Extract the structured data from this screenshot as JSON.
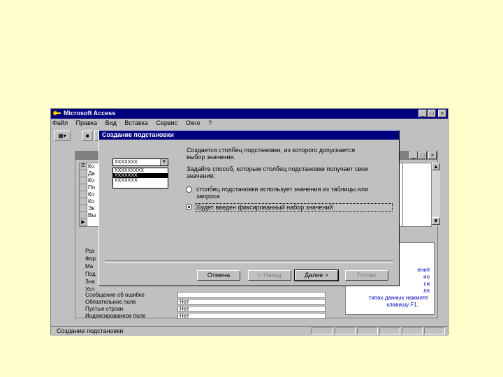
{
  "app": {
    "title": "Microsoft Access",
    "window_buttons": [
      "_",
      "□",
      "×"
    ],
    "menu": [
      "Файл",
      "Правка",
      "Вид",
      "Вставка",
      "Сервис",
      "Окно",
      "?"
    ]
  },
  "table_rows": [
    "Ко",
    "Да",
    "Ко",
    "По",
    "Ко",
    "Ко",
    "Эк",
    "Вы"
  ],
  "properties": [
    {
      "label": "Раз",
      "value": ""
    },
    {
      "label": "Фор",
      "value": ""
    },
    {
      "label": "Ма",
      "value": ""
    },
    {
      "label": "Под",
      "value": ""
    },
    {
      "label": "Зна",
      "value": ""
    },
    {
      "label": "Усл",
      "value": ""
    },
    {
      "label": "Сообщение об ошибке",
      "value": ""
    },
    {
      "label": "Обязательное поле",
      "value": "Нет"
    },
    {
      "label": "Пустые строки",
      "value": "Нет"
    },
    {
      "label": "Индексированное поле",
      "value": "Нет"
    }
  ],
  "hint": [
    "ения",
    "но",
    "си",
    "ля",
    "типах данных нажмите",
    "клавишу F1."
  ],
  "status_text": "Создание подстановки",
  "dialog": {
    "title": "Создание подстановки",
    "preview_combo": "XXXXXXX",
    "preview_list": [
      "XXXXXXXXX",
      "XXXXXXX",
      "XXXXXXX"
    ],
    "intro": [
      "Создается столбец подстановки, из которого допускается",
      "выбор значения."
    ],
    "question": [
      "Задайте способ, которым столбец подстановки получает свои",
      "значения:"
    ],
    "option1": [
      "столбец подстановки использует значения из таблицы или",
      "запроса"
    ],
    "option2": "Будет введен фиксированный набор значений",
    "selected_option": 2,
    "buttons": {
      "cancel": "Отмена",
      "back": "< Назад",
      "next": "Далее >",
      "finish": "Готово"
    }
  }
}
